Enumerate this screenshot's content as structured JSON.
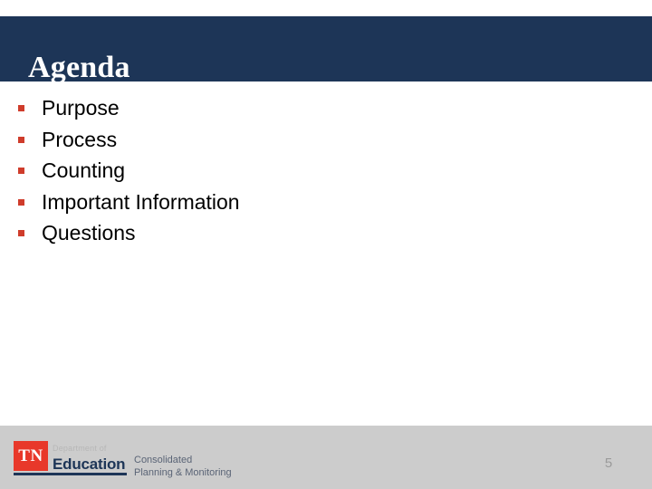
{
  "slide": {
    "title": "Agenda",
    "page_number": "5",
    "colors": {
      "header_navy": "#1d3557",
      "bullet_red": "#cf3c2b",
      "logo_red": "#e8382a",
      "footer_gray": "#cccccc",
      "body_text": "#000000",
      "page_number_gray": "#9a9a9a",
      "division_text": "#5a6476"
    }
  },
  "agenda": {
    "items": [
      {
        "label": "Purpose"
      },
      {
        "label": "Process"
      },
      {
        "label": "Counting"
      },
      {
        "label": "Important Information"
      },
      {
        "label": "Questions"
      }
    ]
  },
  "footer": {
    "logo": {
      "mark_text": "TN",
      "department_of": "Department of",
      "education": "Education"
    },
    "division": {
      "line_1": "Consolidated",
      "line_2": "Planning & Monitoring"
    }
  }
}
